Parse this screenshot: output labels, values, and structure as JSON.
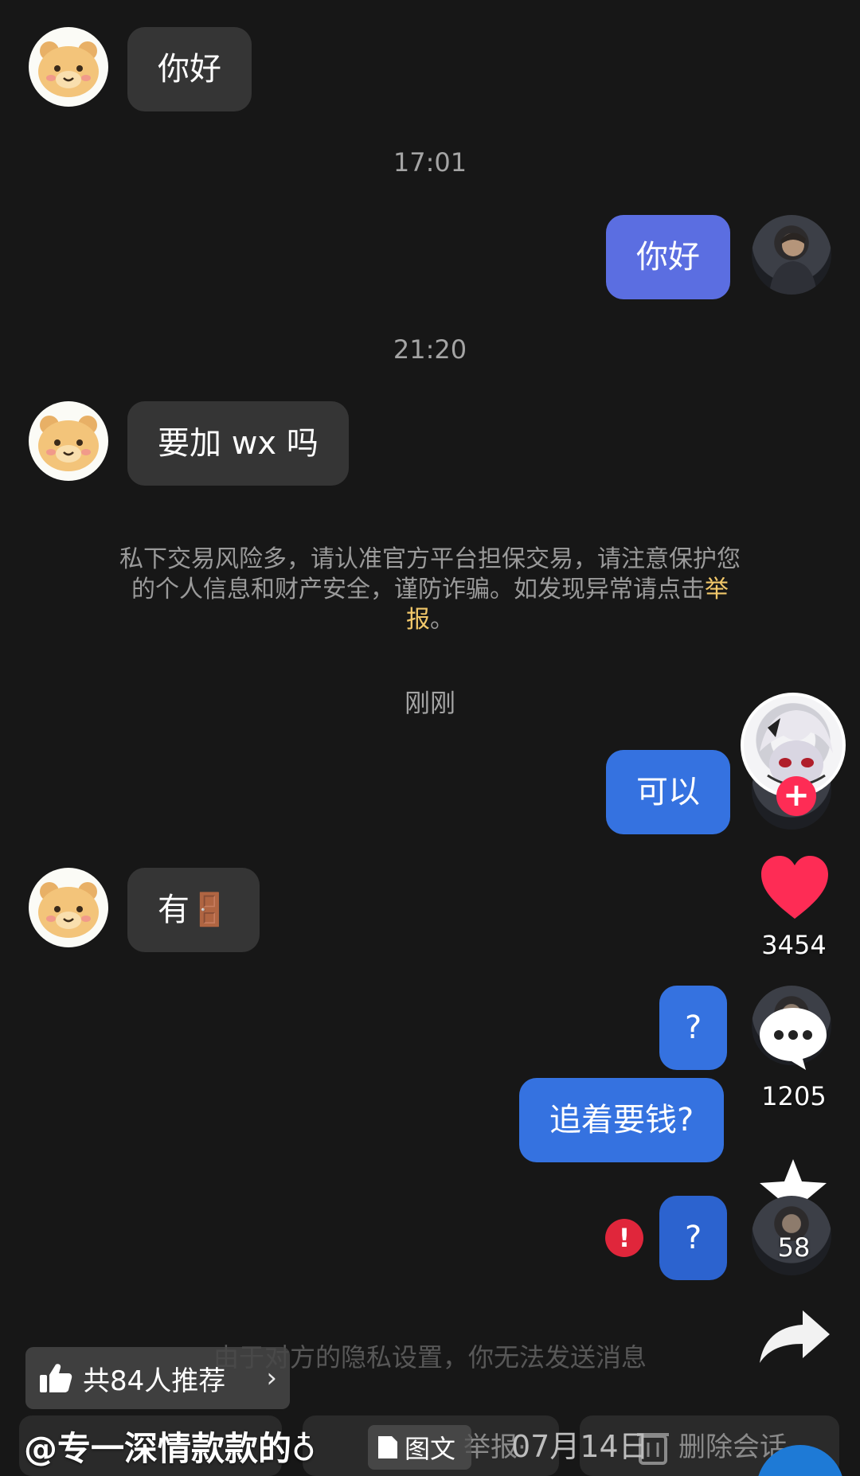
{
  "messages": [
    {
      "side": "in",
      "text": "你好"
    },
    {
      "type": "time",
      "text": "17:01"
    },
    {
      "side": "out",
      "text": "你好"
    },
    {
      "type": "time",
      "text": "21:20"
    },
    {
      "side": "in",
      "text": "要加 wx 吗"
    },
    {
      "type": "notice",
      "text": "私下交易风险多，请认准官方平台担保交易，请注意保护您的个人信息和财产安全，谨防诈骗。如发现异常请点击",
      "link": "举报",
      "suffix": "。"
    },
    {
      "type": "time",
      "text": "刚刚"
    },
    {
      "side": "out",
      "text": "可以"
    },
    {
      "side": "in",
      "text": "有🚪"
    },
    {
      "side": "out",
      "text": "?"
    },
    {
      "side": "out",
      "text": "追着要钱?"
    },
    {
      "side": "out",
      "text": "?",
      "status": "failed"
    }
  ],
  "privacy_note": "由于对方的隐私设置，你无法发送消息",
  "actions": {
    "like_count": "3454",
    "comment_count": "1205",
    "favorite_count": "58",
    "follow_icon": "plus-icon"
  },
  "post": {
    "recommend_text": "共84人推荐",
    "author": "@专一深情款款的♁",
    "tag": "图文",
    "report_label": "举报·",
    "date": "07月14日",
    "delete_label": "删除会话"
  },
  "colors": {
    "background": "#171717",
    "incoming_bubble": "#353535",
    "outgoing_purple": "#5b6ee1",
    "outgoing_blue": "#3572e0",
    "like_red": "#fe2c55",
    "report_link": "#f2c86a"
  }
}
